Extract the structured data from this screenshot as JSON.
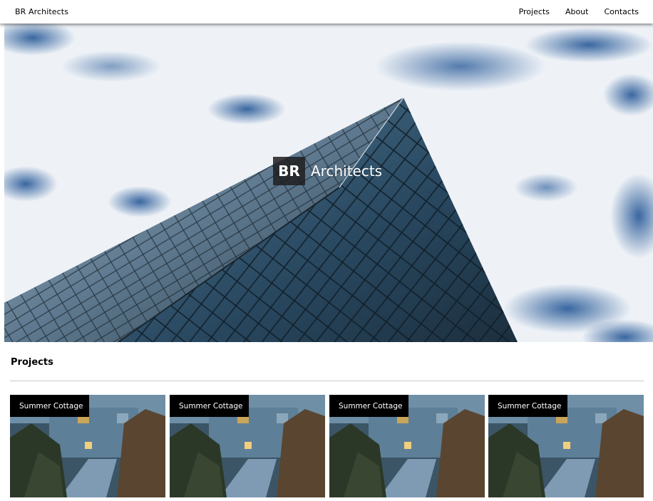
{
  "navbar": {
    "brand": "BR Architects",
    "links": [
      {
        "label": "Projects"
      },
      {
        "label": "About"
      },
      {
        "label": "Contacts"
      }
    ]
  },
  "hero": {
    "logo_mark": "BR",
    "logo_text": "Architects"
  },
  "projects": {
    "title": "Projects",
    "cards": [
      {
        "label": "Summer Cottage"
      },
      {
        "label": "Summer Cottage"
      },
      {
        "label": "Summer Cottage"
      },
      {
        "label": "Summer Cottage"
      }
    ]
  },
  "colors": {
    "sky": "#e9eef5",
    "cloud_blue": "#3d6aa3",
    "glass": "#4a6d86",
    "label_bg": "#000000"
  }
}
